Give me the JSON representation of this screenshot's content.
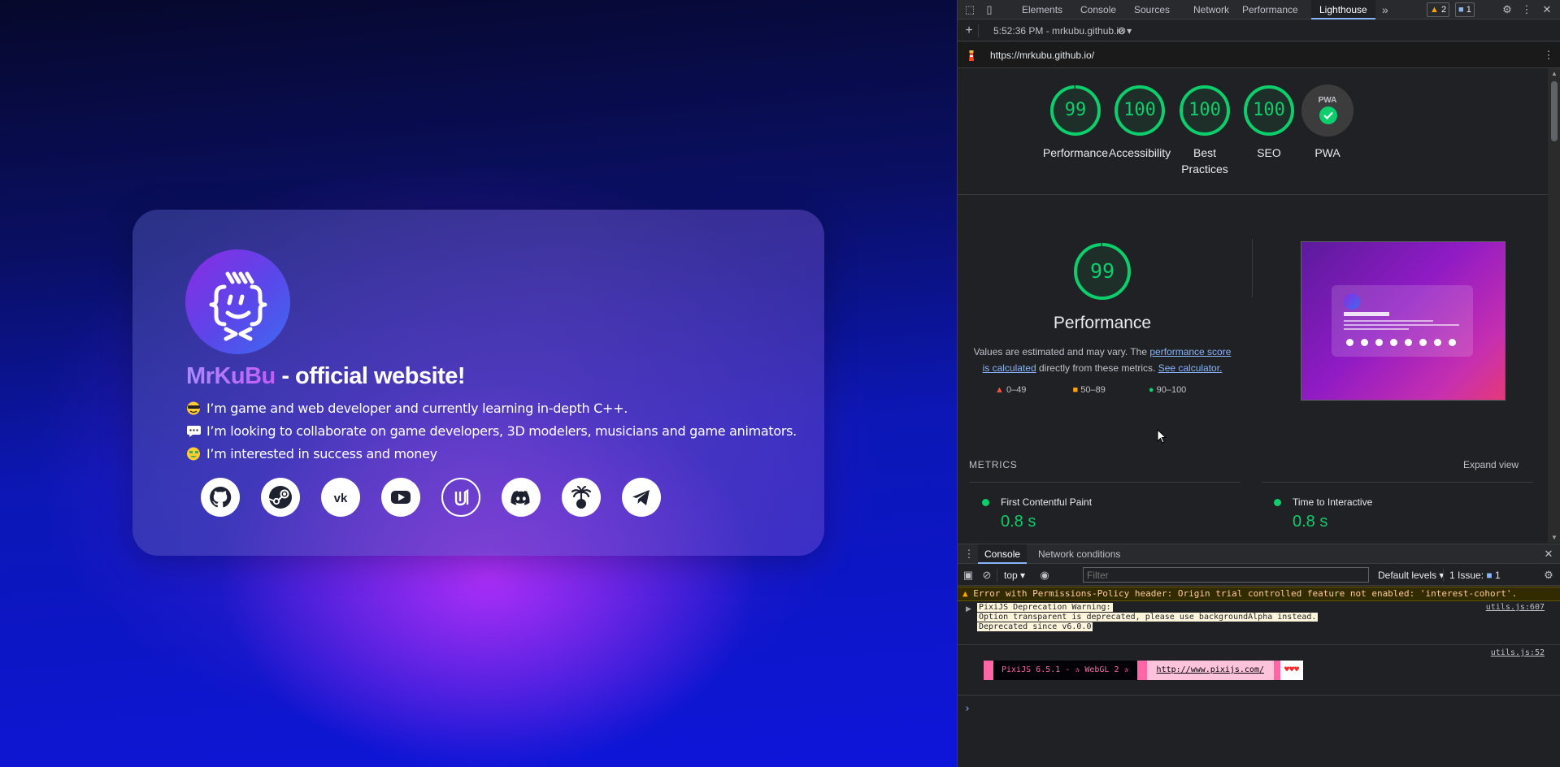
{
  "website": {
    "brand": "MrKuBu",
    "title_rest": " - official website!",
    "bio": [
      {
        "icon": "sunglasses-emoji-icon",
        "text": "I’m game and web developer and currently learning in-depth C++."
      },
      {
        "icon": "speech-bubble-emoji-icon",
        "text": "I’m looking to collaborate on game developers, 3D modelers, musicians and game animators."
      },
      {
        "icon": "money-face-emoji-icon",
        "text": "I’m interested in success and money"
      }
    ],
    "socials": [
      "github-icon",
      "steam-icon",
      "vk-icon",
      "youtube-icon",
      "unreal-engine-icon",
      "discord-icon",
      "itch-palm-icon",
      "telegram-icon"
    ]
  },
  "devtools": {
    "tabs": [
      "Elements",
      "Console",
      "Sources",
      "Network",
      "Performance",
      "Lighthouse"
    ],
    "active_tab": "Lighthouse",
    "more_tabs": "»",
    "warnings_count": "2",
    "messages_count": "1",
    "report_selector": "5:52:36 PM - mrkubu.github.io",
    "report_url": "https://mrkubu.github.io/",
    "scores": [
      {
        "value": "99",
        "label": "Performance",
        "fraction": 0.99
      },
      {
        "value": "100",
        "label": "Accessibility",
        "fraction": 1.0
      },
      {
        "value": "100",
        "label": "Best Practices",
        "fraction": 1.0
      },
      {
        "value": "100",
        "label": "SEO",
        "fraction": 1.0
      }
    ],
    "pwa": {
      "badge": "PWA",
      "label": "PWA"
    },
    "perf": {
      "score": "99",
      "title": "Performance",
      "desc_pre": "Values are estimated and may vary. The ",
      "desc_link1": "performance score is calculated",
      "desc_mid": " directly from these metrics. ",
      "desc_link2": "See calculator.",
      "legend": [
        "0–49",
        "50–89",
        "90–100"
      ]
    },
    "metrics": {
      "heading": "METRICS",
      "expand": "Expand view",
      "items": [
        {
          "label": "First Contentful Paint",
          "value": "0.8 s"
        },
        {
          "label": "Time to Interactive",
          "value": "0.8 s"
        }
      ]
    },
    "drawer": {
      "tabs": [
        "Console",
        "Network conditions"
      ],
      "context": "top",
      "filter_placeholder": "Filter",
      "levels": "Default levels",
      "issues": "1 Issue:",
      "issues_count": "1"
    },
    "console": {
      "error": "Error with Permissions-Policy header: Origin trial controlled feature not enabled: 'interest-cohort'.",
      "warn_lines": [
        "PixiJS Deprecation Warning:",
        "Option transparent is deprecated, please use backgroundAlpha instead.",
        "Deprecated since v6.0.0"
      ],
      "warn_source": "utils.js:607",
      "pixi_source": "utils.js:52",
      "pixi_banner": "PixiJS 6.5.1 - ✰ WebGL 2 ✰",
      "pixi_link": "http://www.pixijs.com/",
      "pixi_hearts": "♥♥♥",
      "prompt": "›"
    },
    "colors": {
      "pass": "#0cce6b",
      "average": "#ffa400",
      "fail": "#ff4e42"
    }
  }
}
